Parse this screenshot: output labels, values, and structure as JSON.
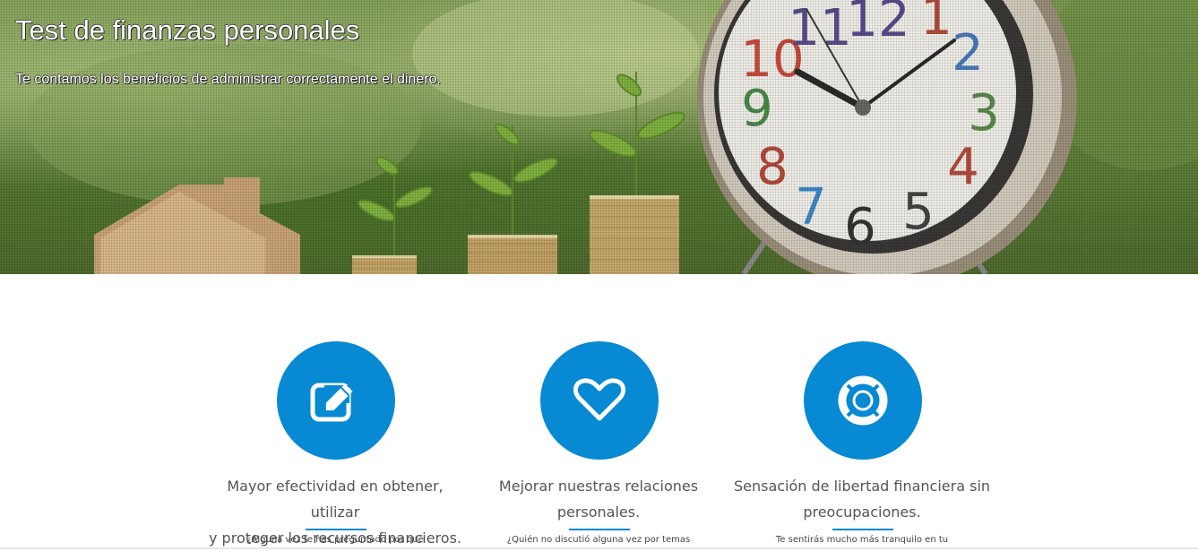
{
  "hero": {
    "title": "Test de finanzas personales",
    "subtitle": "Te contamos los beneficios de administrar correctamente el dinero.",
    "clock_numbers": [
      "12",
      "1",
      "2",
      "3",
      "4",
      "5",
      "6",
      "7",
      "8",
      "9",
      "10",
      "11"
    ]
  },
  "features": [
    {
      "icon": "edit-icon",
      "title_line1": "Mayor efectividad en obtener, utilizar",
      "title_line2": "y proteger los recursos financieros.",
      "text": "¿Alguna vez te has preguntado por qué"
    },
    {
      "icon": "heart-icon",
      "title_line1": "Mejorar nuestras relaciones",
      "title_line2": "personales.",
      "text": "¿Quién no discutió alguna vez por temas"
    },
    {
      "icon": "lifebuoy-icon",
      "title_line1": "Sensación de libertad financiera sin",
      "title_line2": "preocupaciones.",
      "text": "Te sentirás mucho más tranquilo en tu"
    }
  ],
  "colors": {
    "accent": "#0789d4",
    "text": "#555555"
  }
}
